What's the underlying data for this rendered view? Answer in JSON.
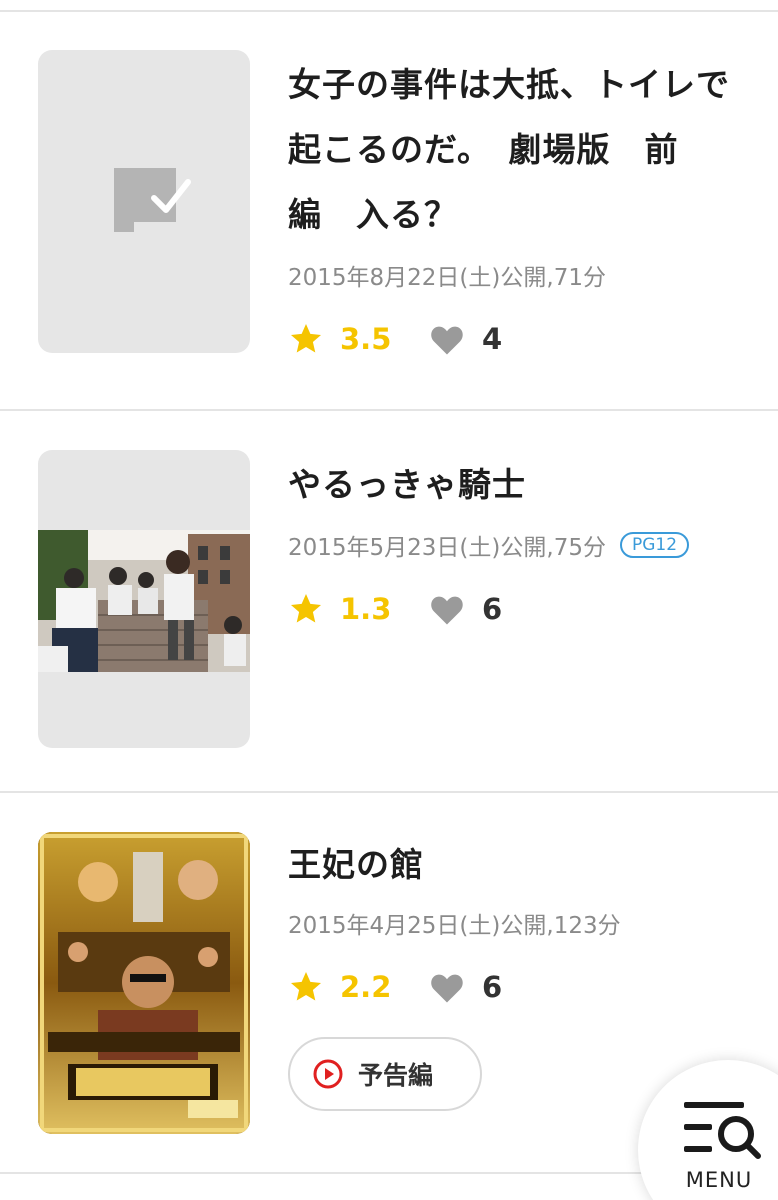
{
  "movies": [
    {
      "title": "女子の事件は大抵、トイレで\n起こるのだ。　劇場版　前\n編　入る？",
      "meta": "2015年8月22日(土)公開,71分",
      "score": "3.5",
      "likes": "4",
      "poster": "placeholder"
    },
    {
      "title": "やるっきゃ騎士",
      "meta": "2015年5月23日(土)公開,75分",
      "rating_badge": "PG12",
      "score": "1.3",
      "likes": "6",
      "poster": "photo-students-staircase"
    },
    {
      "title": "王妃の館",
      "meta": "2015年4月25日(土)公開,123分",
      "score": "2.2",
      "likes": "6",
      "trailer_label": "予告編",
      "poster": "golden-movie-poster"
    }
  ],
  "menu": {
    "label": "MENU"
  },
  "colors": {
    "star": "#f5c400",
    "heart": "#9a9a9a",
    "badge": "#3a9ad9",
    "play": "#e02020",
    "divider": "#e4e4e4"
  }
}
